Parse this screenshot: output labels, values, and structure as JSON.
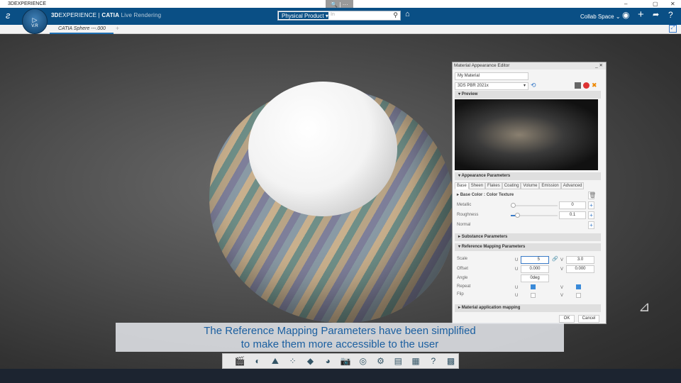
{
  "window": {
    "title": "3DEXPERIENCE",
    "mini_toolbar": "🔍 | ···",
    "controls": [
      "–",
      "▢",
      "✕"
    ]
  },
  "topbar": {
    "brand_bold": "3D",
    "brand_rest": "EXPERIENCE | ",
    "brand_app": "CATIA",
    "brand_role": " Live Rendering",
    "compass_version": "V.R",
    "search_scope": "Physical Product",
    "search_placeholder": "In",
    "collab_space": "Collab Space"
  },
  "tabs": {
    "active": "CATIA Sphere ---.000",
    "add": "+"
  },
  "caption": {
    "line1": "The Reference Mapping Parameters have been simplified",
    "line2": "to make them more accessible to the user"
  },
  "panel": {
    "title": "Material Appearance Editor",
    "material_name": "My Material",
    "shader": "3DS PBR 2021x",
    "preview_label": "Preview",
    "appearance_label": "Appearance Parameters",
    "tabs": [
      "Base",
      "Sheen",
      "Flakes",
      "Coating",
      "Volume",
      "Emission",
      "Advanced"
    ],
    "base_color_label": "Base Color : Color Texture",
    "metallic": {
      "label": "Metallic",
      "value": "0",
      "slider": 0
    },
    "roughness": {
      "label": "Roughness",
      "value": "0.1",
      "slider": 0.1
    },
    "normal_label": "Normal",
    "substance_label": "Substance Parameters",
    "mapping_label": "Reference Mapping Parameters",
    "scale": {
      "label": "Scale",
      "u": "5",
      "v": "3.0"
    },
    "offset": {
      "label": "Offset",
      "u": "0.000",
      "v": "0.000"
    },
    "angle": {
      "label": "Angle",
      "value": "0deg"
    },
    "repeat": {
      "label": "Repeat",
      "u": true,
      "v": true
    },
    "flip": {
      "label": "Flip",
      "u": false,
      "v": false
    },
    "u": "U",
    "v": "V",
    "application_label": "Material application mapping",
    "ok": "OK",
    "cancel": "Cancel"
  },
  "colors": {
    "topbar": "#0a4f85",
    "caption_text": "#1b5fa0",
    "accent": "#3a8ad8"
  }
}
